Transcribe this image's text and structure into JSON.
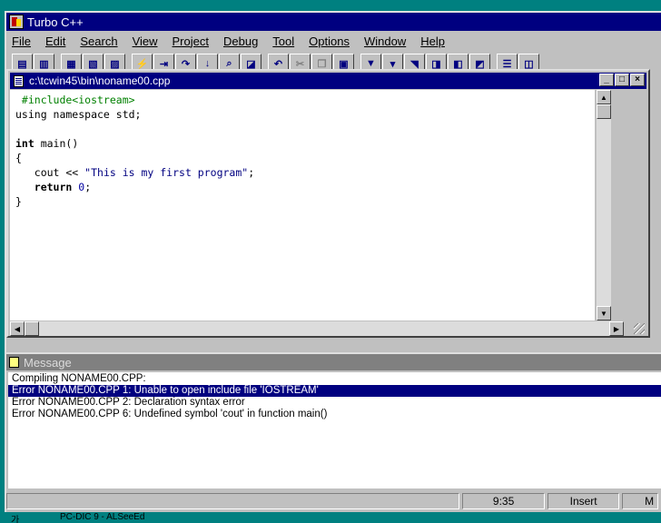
{
  "app": {
    "title": "Turbo C++"
  },
  "menu": [
    "File",
    "Edit",
    "Search",
    "View",
    "Project",
    "Debug",
    "Tool",
    "Options",
    "Window",
    "Help"
  ],
  "editor": {
    "title": "c:\\tcwin45\\bin\\noname00.cpp",
    "lines": [
      {
        "parts": [
          {
            "t": " #include<iostream>",
            "c": "pp"
          }
        ]
      },
      {
        "parts": [
          {
            "t": "using namespace std;",
            "c": ""
          }
        ]
      },
      {
        "parts": [
          {
            "t": "",
            "c": ""
          }
        ]
      },
      {
        "parts": [
          {
            "t": "int",
            "c": "kw"
          },
          {
            "t": " main()",
            "c": ""
          }
        ]
      },
      {
        "parts": [
          {
            "t": "{",
            "c": ""
          }
        ]
      },
      {
        "parts": [
          {
            "t": "   cout << ",
            "c": ""
          },
          {
            "t": "\"This is my first program\"",
            "c": "str"
          },
          {
            "t": ";",
            "c": ""
          }
        ]
      },
      {
        "parts": [
          {
            "t": "   ",
            "c": ""
          },
          {
            "t": "return",
            "c": "kw"
          },
          {
            "t": " ",
            "c": ""
          },
          {
            "t": "0",
            "c": "num"
          },
          {
            "t": ";",
            "c": ""
          }
        ]
      },
      {
        "parts": [
          {
            "t": "}",
            "c": ""
          }
        ]
      }
    ]
  },
  "message": {
    "title": "Message",
    "lines": [
      {
        "text": "Compiling NONAME00.CPP:",
        "selected": false
      },
      {
        "text": "Error NONAME00.CPP 1: Unable to open include file 'IOSTREAM'",
        "selected": true
      },
      {
        "text": "Error NONAME00.CPP 2: Declaration syntax error",
        "selected": false
      },
      {
        "text": "Error NONAME00.CPP 6: Undefined symbol 'cout' in function main()",
        "selected": false
      }
    ]
  },
  "status": {
    "position": "9:35",
    "mode": "Insert",
    "extra": "M"
  },
  "taskbar": {
    "left": "가",
    "middle": "PC-DIC 9 - ALSeeEd"
  }
}
